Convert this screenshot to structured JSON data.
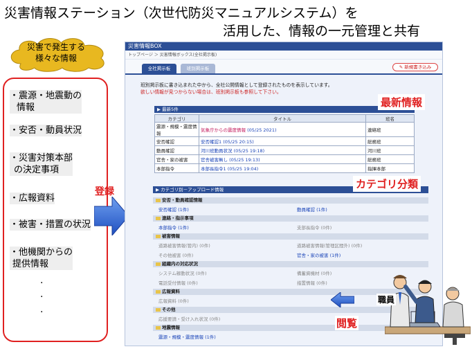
{
  "title": {
    "line1": "災害情報ステーション（次世代防災マニュアルシステム）を",
    "line2": "活用した、情報の一元管理と共有"
  },
  "cloud": {
    "line1": "災害で発生する",
    "line2": "様々な情報"
  },
  "left_items": [
    {
      "line1": "・震源・地震動の",
      "line2": "情報"
    },
    {
      "line1": "・安否・動員状況"
    },
    {
      "line1": "・災害対策本部",
      "line2": "の決定事項"
    },
    {
      "line1": "・広報資料"
    },
    {
      "line1": "・被害・措置の状況"
    },
    {
      "line1": "・他機関からの",
      "line2": "提供情報"
    }
  ],
  "register_label": "登録",
  "panel": {
    "header": "災害情報BOX",
    "breadcrumb": "トップページ ＞ 災害情報ボックス(全社掲示板)",
    "tabs": [
      "全社掲示板",
      "班別掲示板"
    ],
    "new_button": "新規書き込み",
    "intro_line1": "班別掲示板に書き込まれた中から、全社公開情報として登録されたものを表示しています。",
    "intro_line2": "欲しい情報が見つからない場合は、班別掲示板も参照して下さい。",
    "latest_title": "最新5件",
    "latest_headers": [
      "カテゴリ",
      "タイトル",
      "班名"
    ],
    "latest_rows": [
      {
        "cat": "震源・規模・震度情報",
        "title": "気象庁からの震度情報",
        "date": "(05/25 2021)",
        "team": "連絡班"
      },
      {
        "cat": "安否確認",
        "title": "安否確認1",
        "date": "(05/25 20:15)",
        "team": "総務班"
      },
      {
        "cat": "動員確認",
        "title": "河川班動員状況",
        "date": "(05/25 19:18)",
        "team": "河川班"
      },
      {
        "cat": "官舎・家の被害",
        "title": "官舎被害無し",
        "date": "(05/25 19:13)",
        "team": "総務班"
      },
      {
        "cat": "本部指令",
        "title": "本部長指令1",
        "date": "(05/25 19:04)",
        "team": "指揮本部"
      }
    ],
    "category_title": "カテゴリ別－アップロード情報",
    "categories": [
      {
        "name": "安否・動員確認情報",
        "items": [
          "安否確認 (1件)",
          "動員確認 (1件)"
        ]
      },
      {
        "name": "連絡・指示事項",
        "items": [
          "本部指令 (1件)",
          "支部長指令 (0件)"
        ]
      },
      {
        "name": "被害情報",
        "items": [
          "道路被害情報(管内) (0件)",
          "道路被害情報(管理区間外) (0件)",
          "その他被害 (0件)",
          "官舎・家の被害 (1件)"
        ]
      },
      {
        "name": "組織内の対応状況",
        "items": [
          "システム稼動状況 (0件)",
          "備蓄資機材 (0件)",
          "電話受付情報 (0件)",
          "措置情報 (0件)"
        ]
      },
      {
        "name": "広報資料",
        "items": [
          "広報資料 (0件)"
        ]
      },
      {
        "name": "その他",
        "items": [
          "応援要請・受け入れ状況 (0件)"
        ]
      },
      {
        "name": "地震情報",
        "items": [
          "震源・規模・震度情報 (1件)"
        ]
      }
    ]
  },
  "overlay": {
    "latest_label": "最新情報",
    "category_label": "カテゴリ分類",
    "staff_label": "職員",
    "view_label": "閲覧"
  },
  "colors": {
    "accent_red": "#e02020",
    "arrow_blue": "#2a62d8",
    "panel_blue": "#2c4f96",
    "cloud_yellow": "#e8b820"
  }
}
